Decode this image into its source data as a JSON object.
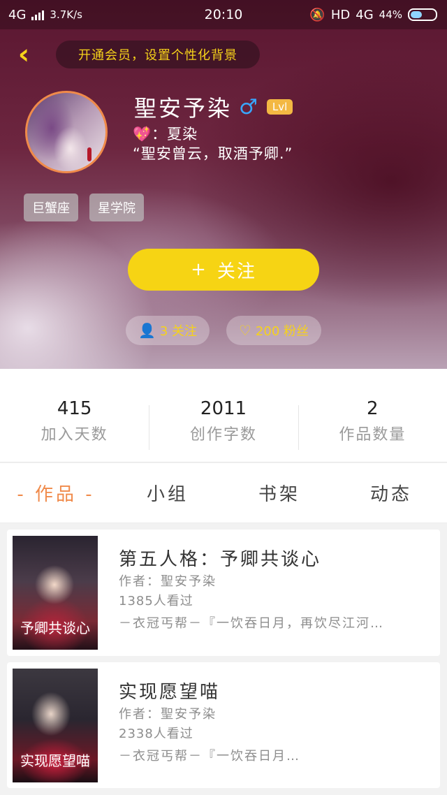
{
  "status_bar": {
    "network": "4G",
    "speed": "3.7K/s",
    "time": "20:10",
    "hd": "HD",
    "network_right": "4G",
    "battery": "44%"
  },
  "header": {
    "back_icon": "chevron-left-icon",
    "vip_banner": "开通会员，设置个性化背景"
  },
  "profile": {
    "name": "聖安予染",
    "gender_symbol": "♂",
    "level": "Lvl",
    "bio_line1": "：夏染",
    "bio_line2": "“聖安曾云，取酒予卿.”",
    "tags": [
      "巨蟹座",
      "星学院"
    ],
    "follow_button": "关注",
    "following_count": "3 关注",
    "fans_count": "200 粉丝"
  },
  "stats": [
    {
      "value": "415",
      "label": "加入天数"
    },
    {
      "value": "2011",
      "label": "创作字数"
    },
    {
      "value": "2",
      "label": "作品数量"
    }
  ],
  "tabs": [
    "- 作品 -",
    "小组",
    "书架",
    "动态"
  ],
  "works": [
    {
      "title": "第五人格：予卿共谈心",
      "author": "作者：聖安予染",
      "views": "1385人看过",
      "desc": "－衣冠丐帮－『一饮吞日月，再饮尽江河…",
      "cover_text": "予卿共谈心"
    },
    {
      "title": "实现愿望喵",
      "author": "作者：聖安予染",
      "views": "2338人看过",
      "desc": "－衣冠丐帮－『一饮吞日月…",
      "cover_text": "实现愿望喵"
    }
  ],
  "colors": {
    "accent": "#f6d414",
    "tab_active": "#f08a4a",
    "gender": "#39a6ff",
    "level_badge": "#f3b843"
  }
}
